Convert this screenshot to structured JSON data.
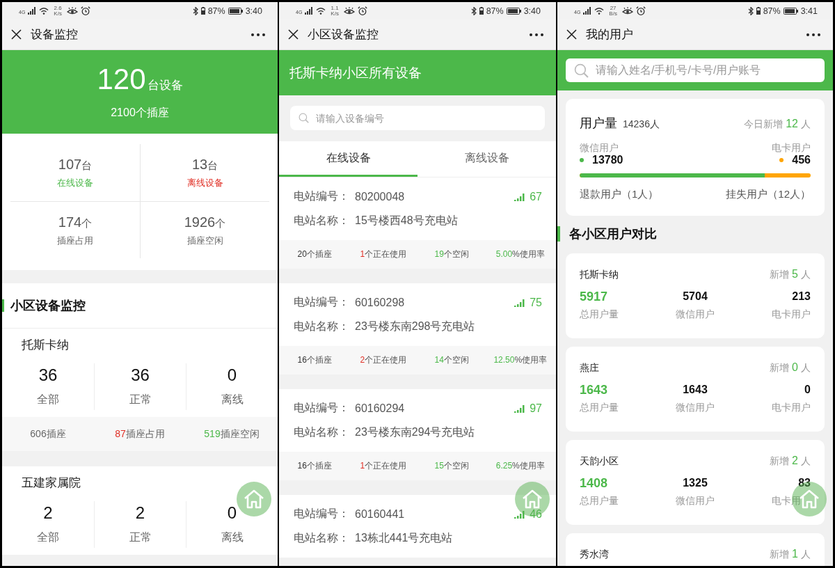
{
  "screens": [
    {
      "kind": "overview",
      "status_bar": {
        "network": "4G",
        "speed": "2.6",
        "speed_unit": "K/s",
        "battery": "87%",
        "time": "3:40"
      },
      "title": "设备监控",
      "summary": {
        "devices": "120",
        "devices_unit": "台设备",
        "sockets": "2100个插座"
      },
      "stats": [
        {
          "value": "107",
          "unit": "台",
          "label": "在线设备",
          "color": "#4cb84a"
        },
        {
          "value": "13",
          "unit": "台",
          "label": "离线设备",
          "color": "#e02e24"
        },
        {
          "value": "174",
          "unit": "个",
          "label": "插座占用",
          "color": "#666666"
        },
        {
          "value": "1926",
          "unit": "个",
          "label": "插座空闲",
          "color": "#666666"
        }
      ],
      "section_title": "小区设备监控",
      "communities": [
        {
          "name": "托斯卡纳",
          "counts": [
            {
              "value": "36",
              "label": "全部"
            },
            {
              "value": "36",
              "label": "正常"
            },
            {
              "value": "0",
              "label": "离线"
            }
          ],
          "sockets": [
            {
              "number": "606",
              "text": "插座",
              "color": "#666666"
            },
            {
              "number": "87",
              "text": "插座占用",
              "color": "#e02e24"
            },
            {
              "number": "519",
              "text": "插座空闲",
              "color": "#4cb84a"
            }
          ]
        },
        {
          "name": "五建家属院",
          "counts": [
            {
              "value": "2",
              "label": "全部"
            },
            {
              "value": "2",
              "label": "正常"
            },
            {
              "value": "0",
              "label": "离线"
            }
          ]
        }
      ]
    },
    {
      "kind": "community_devices",
      "status_bar": {
        "network": "4G",
        "speed": "1.1",
        "speed_unit": "K/s",
        "battery": "87%",
        "time": "3:40"
      },
      "title": "小区设备监控",
      "banner": "托斯卡纳小区所有设备",
      "search": {
        "placeholder": "请输入设备编号"
      },
      "tabs": [
        {
          "label": "在线设备",
          "selected": true
        },
        {
          "label": "离线设备",
          "selected": false
        }
      ],
      "stations": [
        {
          "number_label": "电站编号：",
          "number": "80200048",
          "signal": "67",
          "name_label": "电站名称：",
          "name": "15号楼西48号充电站",
          "stats": [
            {
              "number": "20",
              "text": "个插座",
              "color": "#333333"
            },
            {
              "number": "1",
              "text": "个正在使用",
              "color": "#e02e24"
            },
            {
              "number": "19",
              "text": "个空闲",
              "color": "#4cb84a"
            },
            {
              "number": "5.00",
              "text": "%使用率",
              "color": "#4cb84a"
            }
          ]
        },
        {
          "number_label": "电站编号：",
          "number": "60160298",
          "signal": "75",
          "name_label": "电站名称：",
          "name": "23号楼东南298号充电站",
          "stats": [
            {
              "number": "16",
              "text": "个插座",
              "color": "#333333"
            },
            {
              "number": "2",
              "text": "个正在使用",
              "color": "#e02e24"
            },
            {
              "number": "14",
              "text": "个空闲",
              "color": "#4cb84a"
            },
            {
              "number": "12.50",
              "text": "%使用率",
              "color": "#4cb84a"
            }
          ]
        },
        {
          "number_label": "电站编号：",
          "number": "60160294",
          "signal": "97",
          "name_label": "电站名称：",
          "name": "23号楼东南294号充电站",
          "stats": [
            {
              "number": "16",
              "text": "个插座",
              "color": "#333333"
            },
            {
              "number": "1",
              "text": "个正在使用",
              "color": "#e02e24"
            },
            {
              "number": "15",
              "text": "个空闲",
              "color": "#4cb84a"
            },
            {
              "number": "6.25",
              "text": "%使用率",
              "color": "#4cb84a"
            }
          ]
        },
        {
          "number_label": "电站编号：",
          "number": "60160441",
          "signal": "46",
          "name_label": "电站名称：",
          "name": "13栋北441号充电站"
        }
      ]
    },
    {
      "kind": "users",
      "status_bar": {
        "network": "4G",
        "speed": "27",
        "speed_unit": "B/s",
        "battery": "87%",
        "time": "3:41"
      },
      "title": "我的用户",
      "search": {
        "placeholder": "请输入姓名/手机号/卡号/用户账号"
      },
      "summary": {
        "title": "用户量",
        "total": "14236人",
        "new_label": "今日新增",
        "new_count": "12",
        "new_unit": "人",
        "user_types": [
          {
            "label": "微信用户",
            "value": "13780",
            "color": "#4cb84a"
          },
          {
            "label": "电卡用户",
            "value": "456",
            "color": "#ffa500"
          }
        ],
        "level": 0.8,
        "refunded": "退款用户（1人）",
        "lost": "挂失用户（12人）"
      },
      "section_title": "各小区用户对比",
      "communities": [
        {
          "name": "托斯卡纳",
          "new_label": "新增",
          "new_count": "5",
          "new_unit": "人",
          "values": [
            {
              "value": "5917",
              "label": "总用户量",
              "color": "#4cb84a"
            },
            {
              "value": "5704",
              "label": "微信用户",
              "color": "#111111"
            },
            {
              "value": "213",
              "label": "电卡用户",
              "color": "#111111"
            }
          ]
        },
        {
          "name": "燕庄",
          "new_label": "新增",
          "new_count": "0",
          "new_unit": "人",
          "values": [
            {
              "value": "1643",
              "label": "总用户量",
              "color": "#4cb84a"
            },
            {
              "value": "1643",
              "label": "微信用户",
              "color": "#111111"
            },
            {
              "value": "0",
              "label": "电卡用户",
              "color": "#111111"
            }
          ]
        },
        {
          "name": "天韵小区",
          "new_label": "新增",
          "new_count": "2",
          "new_unit": "人",
          "values": [
            {
              "value": "1408",
              "label": "总用户量",
              "color": "#4cb84a"
            },
            {
              "value": "1325",
              "label": "微信用户",
              "color": "#111111"
            },
            {
              "value": "83",
              "label": "电卡用",
              "color": "#111111"
            }
          ]
        },
        {
          "name": "秀水湾",
          "new_label": "新增",
          "new_count": "1",
          "new_unit": "人"
        }
      ]
    }
  ]
}
